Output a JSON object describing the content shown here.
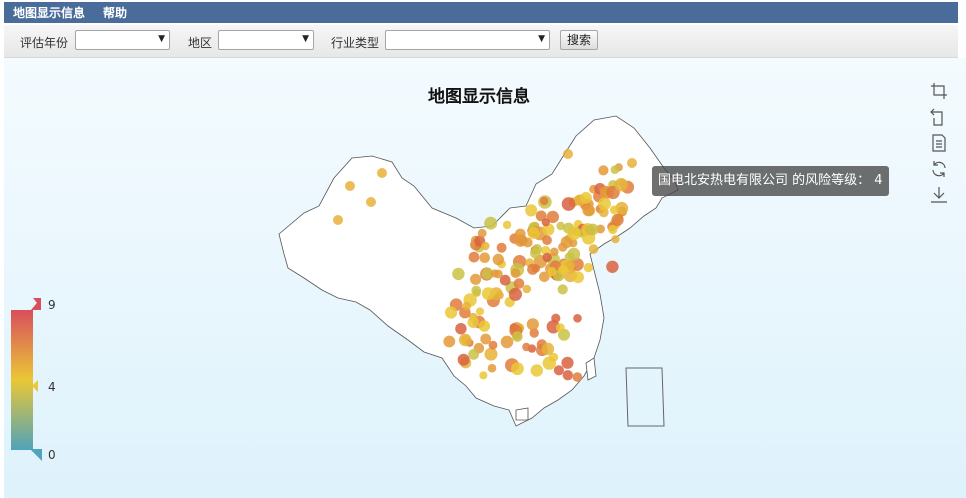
{
  "menu": {
    "items": [
      "地图显示信息",
      "帮助"
    ]
  },
  "filters": {
    "year_label": "评估年份",
    "region_label": "地区",
    "industry_label": "行业类型",
    "year_value": "",
    "region_value": "",
    "industry_value": "",
    "search_button": "搜索"
  },
  "map": {
    "title": "地图显示信息",
    "tooltip": "国电北安热电有限公司 的风险等级： 4"
  },
  "visual_map": {
    "max": "9",
    "handle": "4",
    "min": "0"
  },
  "colors": {
    "high": "#d94e5d",
    "mid": "#eac736",
    "low": "#50a3ba",
    "header": "#4a6c9b"
  },
  "toolbox": [
    "rect-zoom-icon",
    "zoom-reset-icon",
    "data-view-icon",
    "restore-icon",
    "save-image-icon"
  ]
}
